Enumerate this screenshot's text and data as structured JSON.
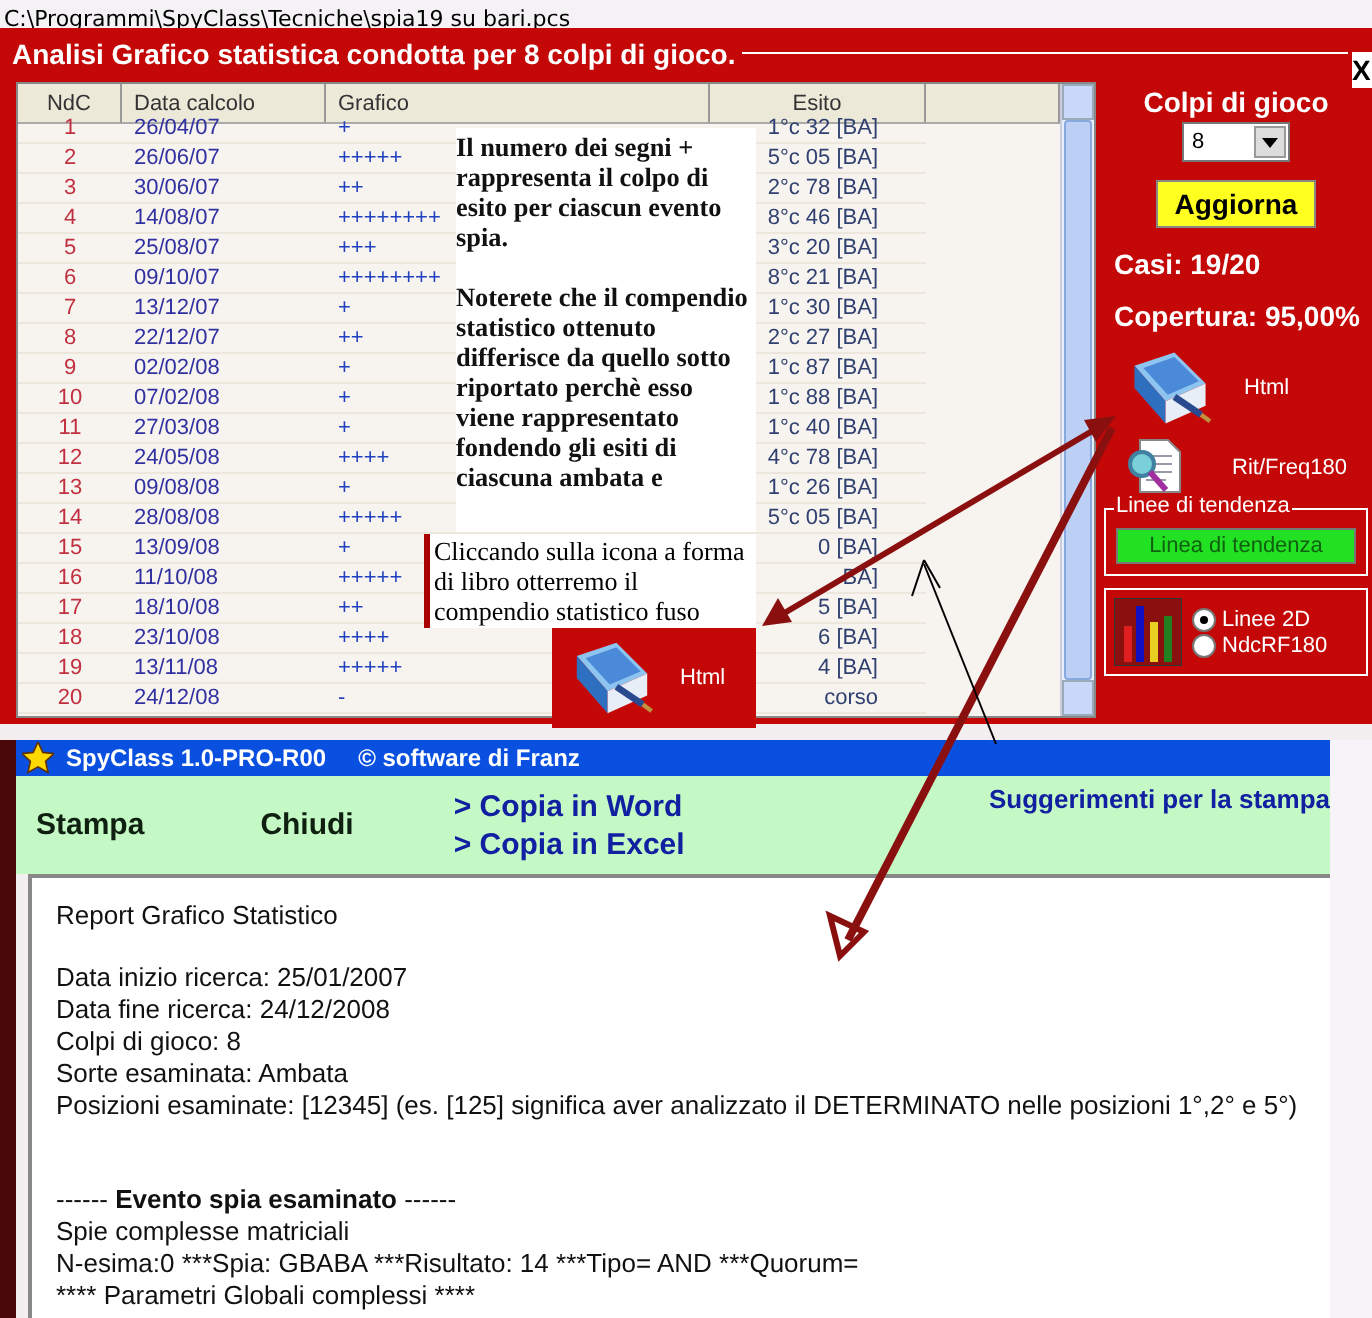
{
  "path_bar": {
    "text": "C:\\Programmi\\SpyClass\\Tecniche\\spia19 su bari.pcs"
  },
  "analysis_panel": {
    "title": "Analisi Grafico statistica condotta per 8 colpi di gioco.",
    "close": "X",
    "table": {
      "columns": [
        "NdC",
        "Data calcolo",
        "Grafico",
        "Esito"
      ],
      "rows": [
        {
          "ndc": "1",
          "date": "26/04/07",
          "chart": "+",
          "esito": "1°c 32 [BA]"
        },
        {
          "ndc": "2",
          "date": "26/06/07",
          "chart": "+++++",
          "esito": "5°c 05 [BA]"
        },
        {
          "ndc": "3",
          "date": "30/06/07",
          "chart": "++",
          "esito": "2°c 78 [BA]"
        },
        {
          "ndc": "4",
          "date": "14/08/07",
          "chart": "++++++++",
          "esito": "8°c 46 [BA]"
        },
        {
          "ndc": "5",
          "date": "25/08/07",
          "chart": "+++",
          "esito": "3°c 20 [BA]"
        },
        {
          "ndc": "6",
          "date": "09/10/07",
          "chart": "++++++++",
          "esito": "8°c 21 [BA]"
        },
        {
          "ndc": "7",
          "date": "13/12/07",
          "chart": "+",
          "esito": "1°c 30 [BA]"
        },
        {
          "ndc": "8",
          "date": "22/12/07",
          "chart": "++",
          "esito": "2°c 27 [BA]"
        },
        {
          "ndc": "9",
          "date": "02/02/08",
          "chart": "+",
          "esito": "1°c 87 [BA]"
        },
        {
          "ndc": "10",
          "date": "07/02/08",
          "chart": "+",
          "esito": "1°c 88 [BA]"
        },
        {
          "ndc": "11",
          "date": "27/03/08",
          "chart": "+",
          "esito": "1°c 40 [BA]"
        },
        {
          "ndc": "12",
          "date": "24/05/08",
          "chart": "++++",
          "esito": "4°c 78 [BA]"
        },
        {
          "ndc": "13",
          "date": "09/08/08",
          "chart": "+",
          "esito": "1°c 26 [BA]"
        },
        {
          "ndc": "14",
          "date": "28/08/08",
          "chart": "+++++",
          "esito": "5°c 05 [BA]"
        },
        {
          "ndc": "15",
          "date": "13/09/08",
          "chart": "+",
          "esito": "0 [BA]"
        },
        {
          "ndc": "16",
          "date": "11/10/08",
          "chart": "+++++",
          "esito": "BA]"
        },
        {
          "ndc": "17",
          "date": "18/10/08",
          "chart": "++",
          "esito": "5 [BA]"
        },
        {
          "ndc": "18",
          "date": "23/10/08",
          "chart": "++++",
          "esito": "6 [BA]"
        },
        {
          "ndc": "19",
          "date": "13/11/08",
          "chart": "+++++",
          "esito": "4 [BA]"
        },
        {
          "ndc": "20",
          "date": "24/12/08",
          "chart": "-",
          "esito": "corso"
        }
      ]
    }
  },
  "controls": {
    "colpi_label": "Colpi di gioco",
    "colpi_value": "8",
    "update_button": "Aggiorna",
    "casi": "Casi: 19/20",
    "copertura": "Copertura: 95,00%",
    "html_label": "Html",
    "rit_label": "Rit/Freq180",
    "trend_group": "Linee di tendenza",
    "trend_button": "Linea di tendenza",
    "chart_options": [
      {
        "label": "Linee 2D",
        "selected": true
      },
      {
        "label": "NdcRF180",
        "selected": false
      }
    ]
  },
  "note": {
    "paragraphs": [
      "Il numero dei segni + rappresenta il colpo di esito per ciascun evento spia.",
      "Noterete che il compendio statistico ottenuto differisce da quello sotto riportato perchè esso viene rappresentato fondendo gli esiti di ciascuna ambata e"
    ]
  },
  "callout": {
    "text": "Cliccando sulla icona a forma di libro otterremo il compendio statistico fuso",
    "button_label": "Html"
  },
  "report_window": {
    "title": "SpyClass 1.0-PRO-R00",
    "subtitle": "© software di Franz",
    "toolbar": {
      "print": "Stampa",
      "close": "Chiudi",
      "copy_links": [
        "> Copia in Word",
        "> Copia in Excel"
      ],
      "tips": "Suggerimenti per la stampa"
    },
    "lines": [
      {
        "kind": "title",
        "text": "Report Grafico Statistico"
      },
      {
        "kind": "text",
        "text": "Data inizio ricerca: 25/01/2007"
      },
      {
        "kind": "text",
        "text": "Data fine ricerca: 24/12/2008"
      },
      {
        "kind": "text",
        "text": "Colpi di gioco: 8"
      },
      {
        "kind": "text",
        "text": "Sorte esaminata: Ambata"
      },
      {
        "kind": "text",
        "text": "Posizioni esaminate: [12345] (es. [125] significa aver analizzato il DETERMINATO nelle posizioni 1°,2° e 5°)"
      },
      {
        "kind": "section",
        "text": "------ **Evento spia esaminato** ------"
      },
      {
        "kind": "text",
        "text": "Spie complesse matriciali"
      },
      {
        "kind": "text",
        "text": "N-esima:0 ***Spia: GBABA ***Risultato: 14 ***Tipo= AND ***Quorum="
      },
      {
        "kind": "text",
        "text": "**** Parametri Globali complessi ****"
      }
    ]
  }
}
